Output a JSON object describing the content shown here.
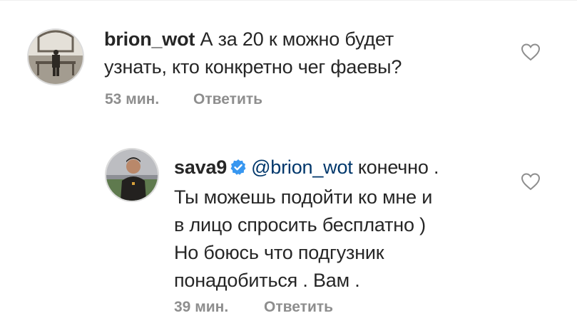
{
  "comment1": {
    "username": "brion_wot",
    "text_line1": "А за 20 к можно будет",
    "text_line2": "узнать, кто конкретно чег фаевы?",
    "time": "53 мин.",
    "reply_label": "Ответить",
    "like_icon": "heart-outline-icon"
  },
  "comment2": {
    "username": "sava9",
    "verified_icon": "verified-badge-icon",
    "mention": "@brion_wot",
    "text_line1": "конечно .",
    "text_line2": "Ты можешь подойти ко мне и",
    "text_line3": "в лицо спросить бесплатно )",
    "text_line4": "Но боюсь что подгузник",
    "text_line5": "понадобиться . Вам .",
    "time": "39 мин.",
    "reply_label": "Ответить",
    "like_icon": "heart-outline-icon"
  },
  "colors": {
    "text": "#262626",
    "secondary": "#8e8e8e",
    "mention": "#00376b",
    "verified": "#3897f0"
  }
}
